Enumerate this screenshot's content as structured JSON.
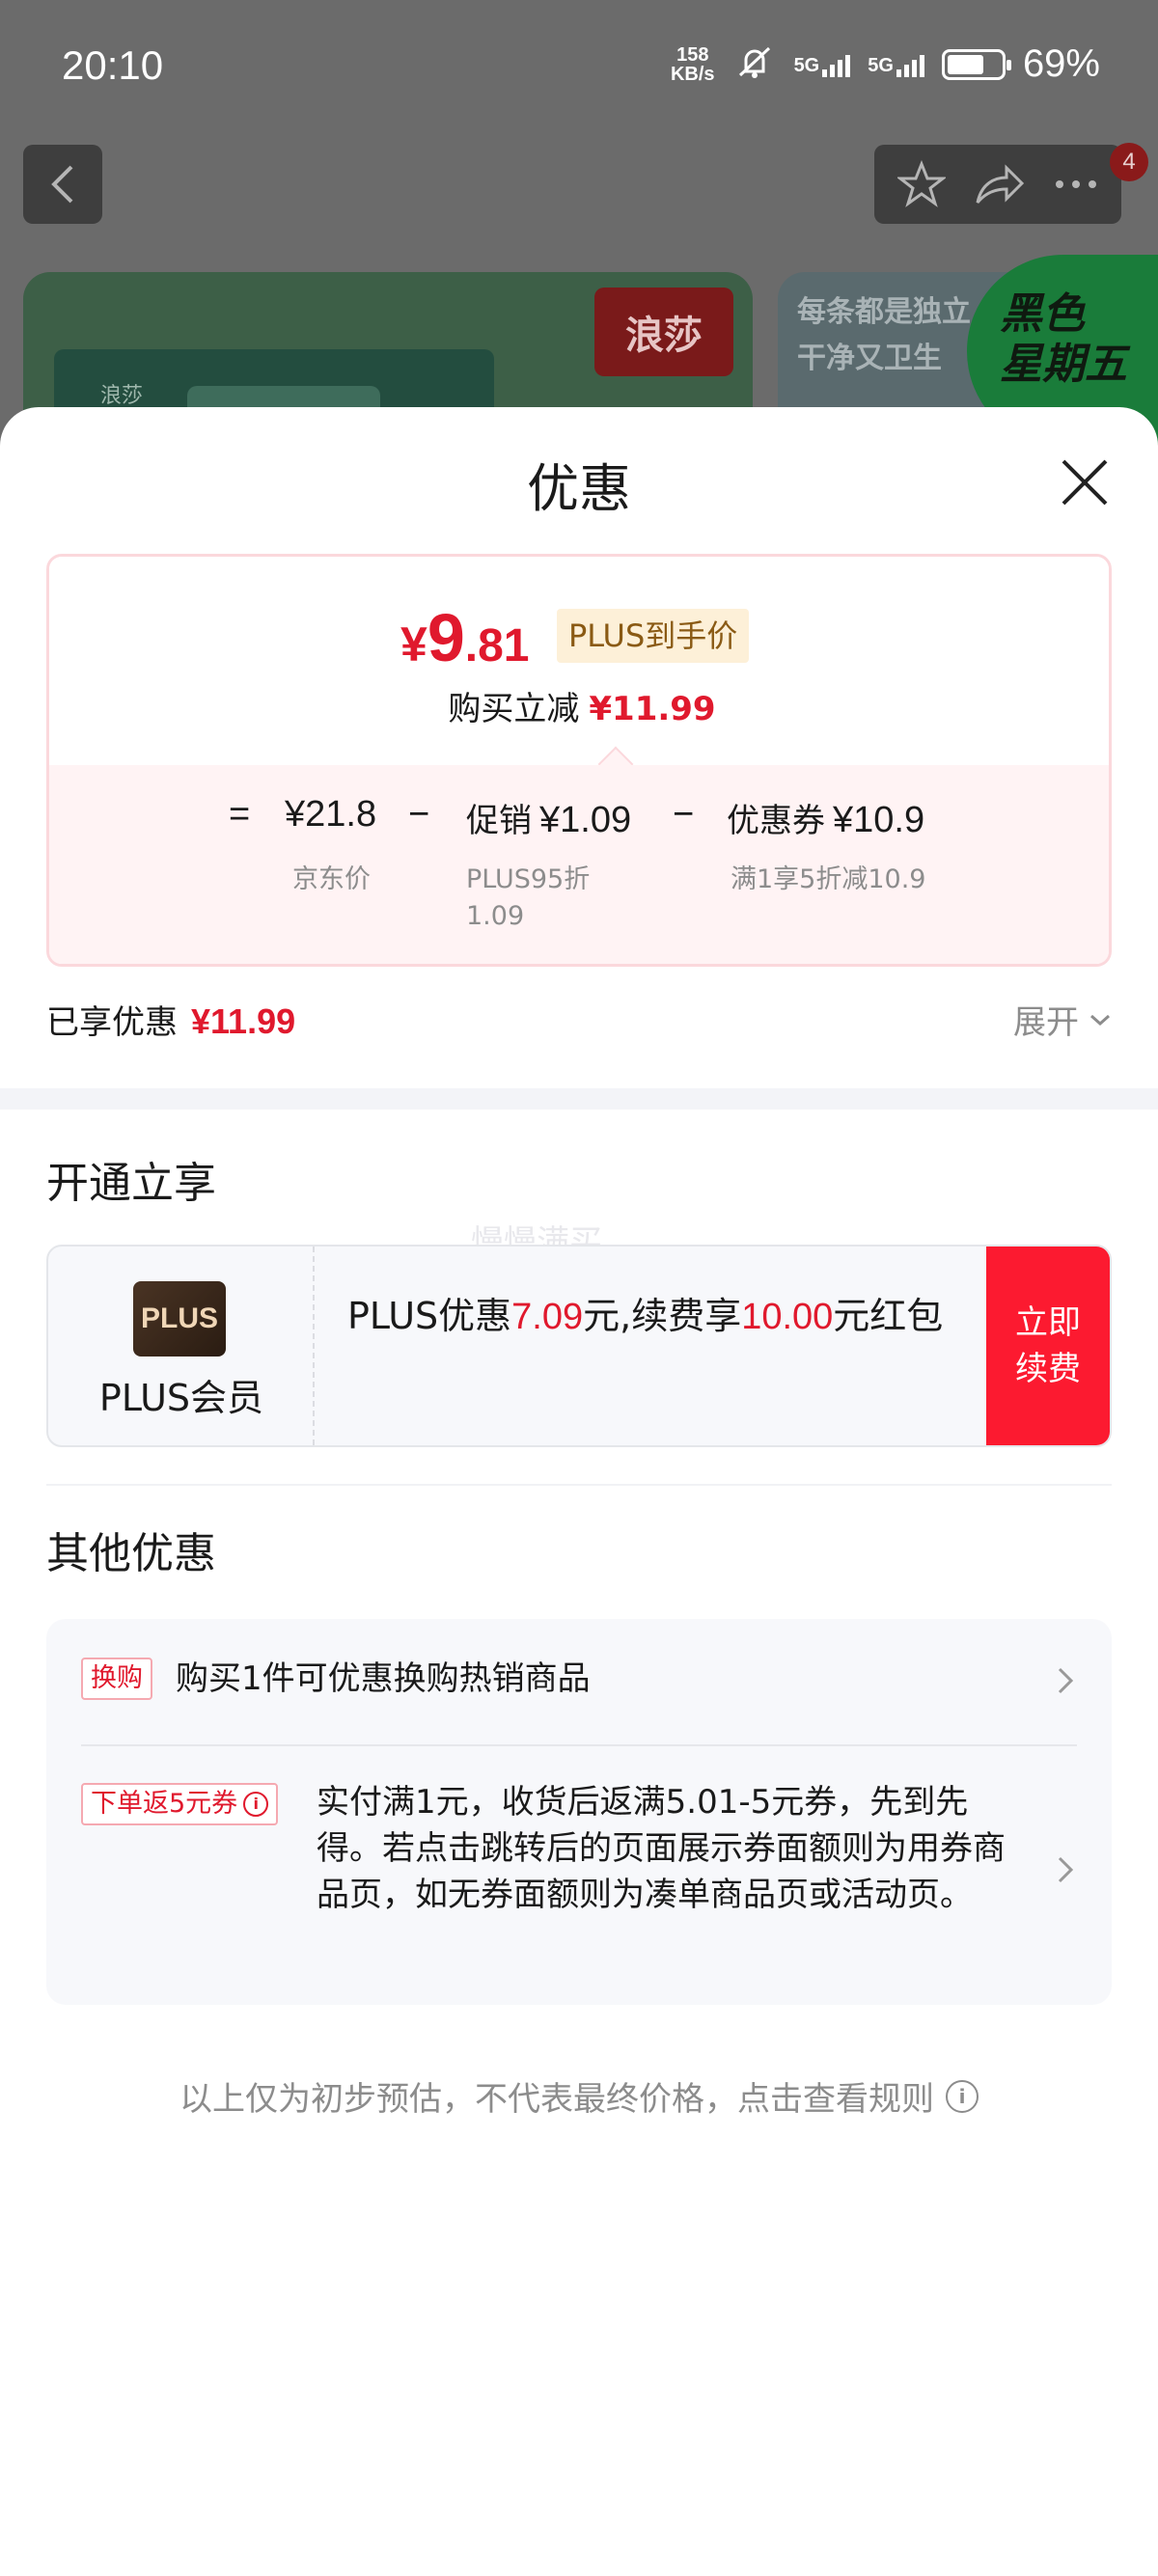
{
  "status_bar": {
    "time": "20:10",
    "net_speed_value": "158",
    "net_speed_unit": "KB/s",
    "signal1_label": "5G",
    "signal2_label": "5G",
    "battery_percent": "69%",
    "battery_level": 0.69,
    "icons": [
      "mute-vibrate-icon",
      "signal-icon",
      "signal-icon",
      "battery-icon"
    ]
  },
  "background_page": {
    "notification_count": "4",
    "brand_logo_text": "浪莎",
    "brand_box_text": "浪莎",
    "card2_line1": "每条都是独立",
    "card2_line2": "干净又卫生",
    "promo_badge_line1": "黑色",
    "promo_badge_line2": "星期五"
  },
  "sheet": {
    "title": "优惠",
    "close_icon": "close-icon"
  },
  "calculation": {
    "final_price_currency": "¥",
    "final_price_int": "9",
    "final_price_dec": ".81",
    "price_tag": "PLUS到手价",
    "reduce_label": "购买立减",
    "reduce_amount": "¥11.99",
    "equals": "=",
    "jd_price": "¥21.8",
    "jd_price_label": "京东价",
    "minus": "−",
    "promo_label": "促销",
    "promo_amount": "¥1.09",
    "promo_sub": "PLUS95折 1.09",
    "coupon_label": "优惠券",
    "coupon_amount": "¥10.9",
    "coupon_sub": "满1享5折减10.9"
  },
  "enjoyed": {
    "label": "已享优惠",
    "amount": "¥11.99",
    "expand_label": "展开"
  },
  "open_section": {
    "title": "开通立享",
    "watermark": "慢慢满买",
    "plus_logo_text": "PLUS",
    "plus_name": "PLUS会员",
    "desc_prefix": "PLUS优惠",
    "desc_amount1": "7.09",
    "desc_mid": "元,续费享",
    "desc_amount2": "10.00",
    "desc_suffix": "元红包",
    "renew_line1": "立即",
    "renew_line2": "续费"
  },
  "other_section": {
    "title": "其他优惠",
    "offers": [
      {
        "tag": "换购",
        "text": "购买1件可优惠换购热销商品"
      },
      {
        "tag": "下单返5元券",
        "text": "实付满1元，收货后返满5.01-5元券，先到先得。若点击跳转后的页面展示券面额则为用券商品页，如无券面额则为凑单商品页或活动页。"
      }
    ]
  },
  "disclaimer": {
    "text": "以上仅为初步预估，不代表最终价格，点击查看规则",
    "info_glyph": "i"
  },
  "colors": {
    "accent_red": "#e0192d",
    "renew_red": "#fc1a30",
    "plus_tag_bg": "#fdf0d8"
  }
}
